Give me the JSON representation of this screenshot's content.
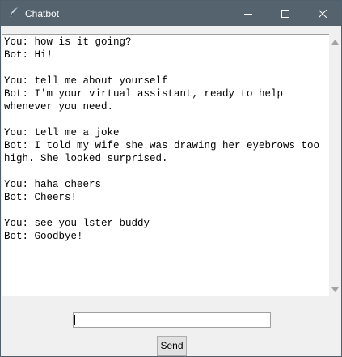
{
  "window": {
    "title": "Chatbot",
    "app_icon": "feather-icon",
    "controls": {
      "minimize_icon": "minimize-icon",
      "maximize_icon": "maximize-icon",
      "close_icon": "close-icon"
    }
  },
  "chat": {
    "transcript": "You: how is it going?\nBot: Hi!\n\nYou: tell me about yourself\nBot: I'm your virtual assistant, ready to help whenever you need.\n\nYou: tell me a joke\nBot: I told my wife she was drawing her eyebrows too high. She looked surprised.\n\nYou: haha cheers\nBot: Cheers!\n\nYou: see you lster buddy\nBot: Goodbye!"
  },
  "input": {
    "value": "",
    "placeholder": ""
  },
  "send_button": {
    "label": "Send"
  },
  "colors": {
    "titlebar": "#55636e",
    "window_bg": "#f0f0f0",
    "text_bg": "#ffffff",
    "button_bg": "#e1e1e1"
  }
}
